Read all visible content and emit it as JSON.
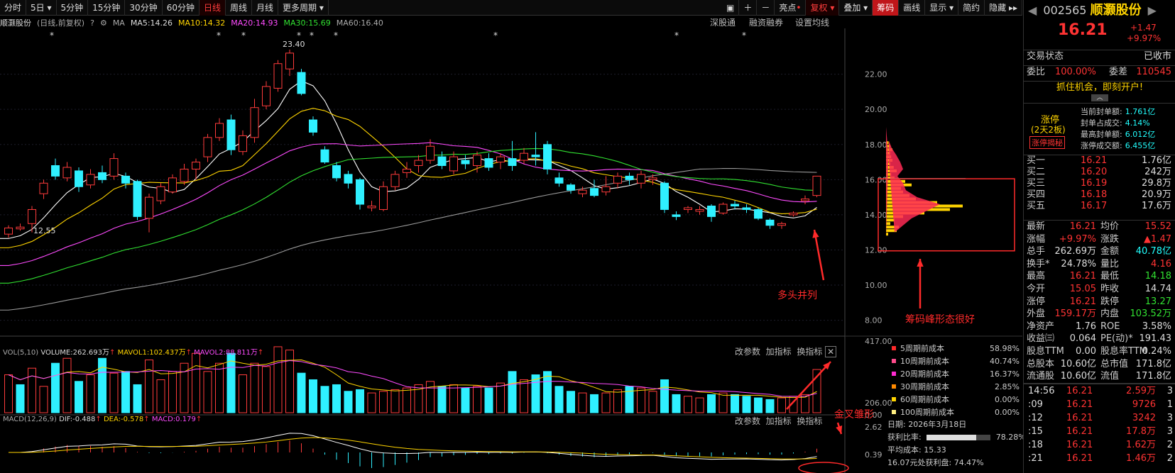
{
  "toolbar": {
    "items": [
      "分时",
      "5日",
      "5分钟",
      "15分钟",
      "30分钟",
      "60分钟",
      "日线",
      "周线",
      "月线",
      "更多周期"
    ],
    "right": [
      "亮点",
      "复权",
      "叠加",
      "筹码",
      "画线",
      "显示",
      "简约",
      "隐藏"
    ]
  },
  "title": {
    "name": "顺灏股份",
    "mode": "(日线,前复权)",
    "ma_label": "MA",
    "ma5": "MA5:14.26",
    "ma10": "MA10:14.32",
    "ma20": "MA20:14.93",
    "ma30": "MA30:15.69",
    "ma60": "MA60:16.40"
  },
  "right_tools": {
    "a": "深股通",
    "b": "融资融券",
    "c": "设置均线"
  },
  "price_axis": [
    "22.00",
    "20.00",
    "18.00",
    "16.00",
    "14.00",
    "12.00",
    "10.00",
    "8.00"
  ],
  "high_label": "23.40",
  "low_label": "12.55",
  "volume": {
    "title": "VOL(5,10)",
    "volume": "VOLUME:262.693万",
    "mavol1": "MAVOL1:102.437万",
    "mavol2": "MAVOL2:88.811万",
    "axis": [
      "417.00",
      "206.00",
      "0.00"
    ],
    "tools": [
      "改参数",
      "加指标",
      "换指标"
    ]
  },
  "macd": {
    "title": "MACD(12,26,9)",
    "dif": "DIF:-0.488",
    "dea": "DEA:-0.578",
    "macd": "MACD:0.179",
    "axis": [
      "2.62",
      "0.39"
    ],
    "tools": [
      "改参数",
      "加指标",
      "换指标"
    ]
  },
  "chip_legend": [
    {
      "label": "5周期前成本",
      "value": "58.98%",
      "color": "#ff2a2a"
    },
    {
      "label": "10周期前成本",
      "value": "40.74%",
      "color": "#ff4b8c"
    },
    {
      "label": "20周期前成本",
      "value": "16.37%",
      "color": "#ff2bd2"
    },
    {
      "label": "30周期前成本",
      "value": "2.85%",
      "color": "#ff8a00"
    },
    {
      "label": "60周期前成本",
      "value": "0.00%",
      "color": "#ffd400"
    },
    {
      "label": "100周期前成本",
      "value": "0.00%",
      "color": "#ffef80"
    }
  ],
  "chip_info": {
    "date": "日期: 2026年3月18日",
    "profit_label": "获利比率:",
    "profit": "78.28%",
    "avg": "平均成本: 15.33",
    "profit_at": "16.07元处获利盘: 74.47%"
  },
  "annotations": {
    "a": "多头并列",
    "b": "筹码峰形态很好",
    "c": "金叉雏形"
  },
  "panel": {
    "code": "002565",
    "name": "顺灏股份",
    "price": "16.21",
    "chg": "+1.47",
    "pct": "+9.97%",
    "status_label": "交易状态",
    "status": "已收市",
    "wb_label": "委比",
    "wb": "100.00%",
    "wc_label": "委差",
    "wc": "110545",
    "promo": "抓住机会，即刻开户!",
    "limit_title": "涨停",
    "limit_sub": "(2天2板)",
    "limit_btn": "涨停揭秘",
    "seal": [
      [
        "当前封单额:",
        "1.761亿"
      ],
      [
        "封单占成交:",
        "4.14%"
      ],
      [
        "最高封单额:",
        "6.012亿"
      ],
      [
        "涨停成交额:",
        "6.455亿"
      ]
    ],
    "bids": [
      [
        "买一",
        "16.21",
        "1.76亿"
      ],
      [
        "买二",
        "16.20",
        "242万"
      ],
      [
        "买三",
        "16.19",
        "29.8万"
      ],
      [
        "买四",
        "16.18",
        "20.9万"
      ],
      [
        "买五",
        "16.17",
        "17.6万"
      ]
    ],
    "stats": [
      [
        "最新",
        "16.21",
        "均价",
        "15.52"
      ],
      [
        "涨幅",
        "+9.97%",
        "涨跌",
        "▲1.47"
      ],
      [
        "总手",
        "262.69万",
        "金额",
        "40.78亿"
      ],
      [
        "换手*",
        "24.78%",
        "量比",
        "4.16"
      ],
      [
        "最高",
        "16.21",
        "最低",
        "14.18"
      ],
      [
        "今开",
        "15.05",
        "昨收",
        "14.74"
      ],
      [
        "涨停",
        "16.21",
        "跌停",
        "13.27"
      ],
      [
        "外盘",
        "159.17万",
        "内盘",
        "103.52万"
      ],
      [
        "净资产",
        "1.76",
        "ROE",
        "3.58%"
      ],
      [
        "收益㈢",
        "0.064",
        "PE(动)*",
        "191.43"
      ],
      [
        "股息TTM",
        "0.00",
        "股息率TTM",
        "0.24%"
      ],
      [
        "总股本",
        "10.60亿",
        "总市值",
        "171.8亿"
      ],
      [
        "流通股",
        "10.60亿",
        "流值",
        "171.8亿"
      ]
    ],
    "ticks": [
      [
        "14:56",
        "16.21",
        "2.59万",
        "3"
      ],
      [
        ":09",
        "16.21",
        "9726",
        "1"
      ],
      [
        ":12",
        "16.21",
        "3242",
        "3"
      ],
      [
        ":15",
        "16.21",
        "17.8万",
        "3"
      ],
      [
        ":18",
        "16.21",
        "1.62万",
        "2"
      ],
      [
        ":21",
        "16.21",
        "1.46万",
        "2"
      ]
    ]
  },
  "candles": [
    [
      12.9,
      13.25,
      12.7,
      13.4
    ],
    [
      13.2,
      13.3,
      13.1,
      13.5
    ],
    [
      13.5,
      14.3,
      13.0,
      14.5
    ],
    [
      15.2,
      15.8,
      14.9,
      16.0
    ],
    [
      16.8,
      16.2,
      16.0,
      17.2
    ],
    [
      16.1,
      16.7,
      15.9,
      17.0
    ],
    [
      16.5,
      15.6,
      15.3,
      16.7
    ],
    [
      15.7,
      16.3,
      15.5,
      16.6
    ],
    [
      16.4,
      16.0,
      15.8,
      16.8
    ],
    [
      16.2,
      17.2,
      16.0,
      17.5
    ],
    [
      16.2,
      15.8,
      15.5,
      16.4
    ],
    [
      15.9,
      13.9,
      13.7,
      16.0
    ],
    [
      13.8,
      15.0,
      13.0,
      15.2
    ],
    [
      14.8,
      15.6,
      14.6,
      15.8
    ],
    [
      15.3,
      16.1,
      15.2,
      16.3
    ],
    [
      15.9,
      16.6,
      15.7,
      16.9
    ],
    [
      16.6,
      17.0,
      16.0,
      17.2
    ],
    [
      17.3,
      18.4,
      17.0,
      18.6
    ],
    [
      18.4,
      19.2,
      18.2,
      19.5
    ],
    [
      19.4,
      17.7,
      17.4,
      19.7
    ],
    [
      17.6,
      18.5,
      17.4,
      18.8
    ],
    [
      18.4,
      20.1,
      18.1,
      20.6
    ],
    [
      20.2,
      21.3,
      20.0,
      21.6
    ],
    [
      21.2,
      22.6,
      21.0,
      22.8
    ],
    [
      22.3,
      23.2,
      21.9,
      23.4
    ],
    [
      22.1,
      20.9,
      20.8,
      22.3
    ],
    [
      19.4,
      18.7,
      18.5,
      19.6
    ],
    [
      17.7,
      17.0,
      16.9,
      17.9
    ],
    [
      16.8,
      16.1,
      15.9,
      17.0
    ],
    [
      16.3,
      15.8,
      15.5,
      16.5
    ],
    [
      16.0,
      14.6,
      14.3,
      16.1
    ],
    [
      14.4,
      14.5,
      14.2,
      14.8
    ],
    [
      14.3,
      15.6,
      14.2,
      15.9
    ],
    [
      15.6,
      16.3,
      15.4,
      16.5
    ],
    [
      16.4,
      16.6,
      16.1,
      17.0
    ],
    [
      16.8,
      17.1,
      16.4,
      17.4
    ],
    [
      17.1,
      17.9,
      16.9,
      18.3
    ],
    [
      17.3,
      16.8,
      16.6,
      17.6
    ],
    [
      16.5,
      17.3,
      16.3,
      17.6
    ],
    [
      17.1,
      16.9,
      16.6,
      17.4
    ],
    [
      16.8,
      17.4,
      16.4,
      17.6
    ],
    [
      17.2,
      16.7,
      16.5,
      17.5
    ],
    [
      17.0,
      17.3,
      16.6,
      17.5
    ],
    [
      17.2,
      16.8,
      16.5,
      18.2
    ],
    [
      17.1,
      17.5,
      16.9,
      17.8
    ],
    [
      17.4,
      17.3,
      16.8,
      18.7
    ],
    [
      18.0,
      16.6,
      16.3,
      18.2
    ],
    [
      16.1,
      15.8,
      15.6,
      16.4
    ],
    [
      15.7,
      15.4,
      15.2,
      15.8
    ],
    [
      15.2,
      15.4,
      15.0,
      15.6
    ],
    [
      15.5,
      15.1,
      15.0,
      16.0
    ],
    [
      15.3,
      15.6,
      15.1,
      16.2
    ],
    [
      15.8,
      16.2,
      15.5,
      16.4
    ],
    [
      16.2,
      16.0,
      15.7,
      16.4
    ],
    [
      15.8,
      16.3,
      15.5,
      16.5
    ],
    [
      16.0,
      16.1,
      15.7,
      16.3
    ],
    [
      15.8,
      14.3,
      14.1,
      15.9
    ],
    [
      14.0,
      13.9,
      13.7,
      14.2
    ],
    [
      14.3,
      14.4,
      14.1,
      14.5
    ],
    [
      14.2,
      14.3,
      14.0,
      14.5
    ],
    [
      14.5,
      13.9,
      13.6,
      14.6
    ],
    [
      14.1,
      14.6,
      14.0,
      14.7
    ],
    [
      14.6,
      14.5,
      14.3,
      14.8
    ],
    [
      14.4,
      14.3,
      14.1,
      14.6
    ],
    [
      14.3,
      13.8,
      13.7,
      14.4
    ],
    [
      13.7,
      13.4,
      13.2,
      13.8
    ],
    [
      13.4,
      13.5,
      13.2,
      13.6
    ],
    [
      14.0,
      14.1,
      13.9,
      14.2
    ],
    [
      14.8,
      14.9,
      14.6,
      15.1
    ],
    [
      15.1,
      16.2,
      15.0,
      16.21
    ]
  ],
  "vol": [
    230,
    170,
    270,
    160,
    300,
    330,
    190,
    230,
    330,
    240,
    250,
    170,
    320,
    200,
    250,
    300,
    360,
    250,
    300,
    360,
    230,
    300,
    280,
    400,
    380,
    240,
    200,
    160,
    170,
    130,
    140,
    120,
    130,
    140,
    150,
    170,
    190,
    160,
    170,
    150,
    160,
    150,
    180,
    250,
    200,
    230,
    250,
    160,
    130,
    120,
    110,
    120,
    140,
    160,
    150,
    130,
    200,
    110,
    100,
    90,
    110,
    120,
    110,
    100,
    90,
    80,
    90,
    100,
    110,
    262
  ],
  "volcolor": [
    0,
    1,
    0,
    0,
    1,
    0,
    1,
    0,
    1,
    0,
    1,
    1,
    0,
    0,
    0,
    0,
    0,
    0,
    0,
    1,
    0,
    0,
    0,
    0,
    0,
    1,
    1,
    1,
    1,
    1,
    1,
    0,
    0,
    0,
    0,
    0,
    0,
    1,
    0,
    1,
    0,
    1,
    0,
    1,
    0,
    1,
    1,
    1,
    1,
    0,
    1,
    0,
    0,
    1,
    0,
    0,
    1,
    1,
    0,
    0,
    1,
    0,
    1,
    1,
    1,
    1,
    0,
    0,
    0,
    0
  ]
}
